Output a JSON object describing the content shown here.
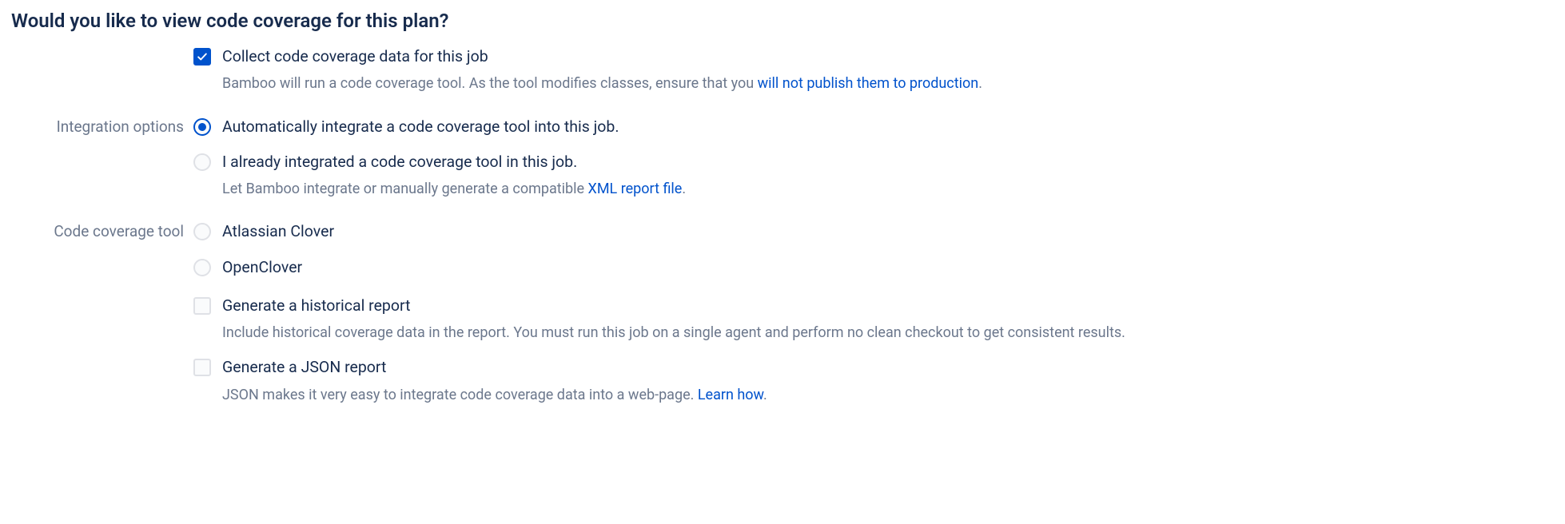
{
  "heading": "Would you like to view code coverage for this plan?",
  "collect": {
    "label": "Collect code coverage data for this job",
    "checked": true,
    "desc_prefix": "Bamboo will run a code coverage tool. As the tool modifies classes, ensure that you ",
    "desc_link": "will not publish them to production",
    "desc_suffix": "."
  },
  "integration": {
    "section_label": "Integration options",
    "auto": {
      "label": "Automatically integrate a code coverage tool into this job.",
      "selected": true
    },
    "manual": {
      "label": "I already integrated a code coverage tool in this job.",
      "selected": false
    },
    "desc_prefix": "Let Bamboo integrate or manually generate a compatible ",
    "desc_link": "XML report file",
    "desc_suffix": "."
  },
  "tool": {
    "section_label": "Code coverage tool",
    "clover": {
      "label": "Atlassian Clover",
      "selected": false
    },
    "openclover": {
      "label": "OpenClover",
      "selected": false
    },
    "historical": {
      "label": "Generate a historical report",
      "checked": false,
      "desc": "Include historical coverage data in the report. You must run this job on a single agent and perform no clean checkout to get consistent results."
    },
    "json": {
      "label": "Generate a JSON report",
      "checked": false,
      "desc_prefix": "JSON makes it very easy to integrate code coverage data into a web-page. ",
      "desc_link": "Learn how",
      "desc_suffix": "."
    }
  }
}
